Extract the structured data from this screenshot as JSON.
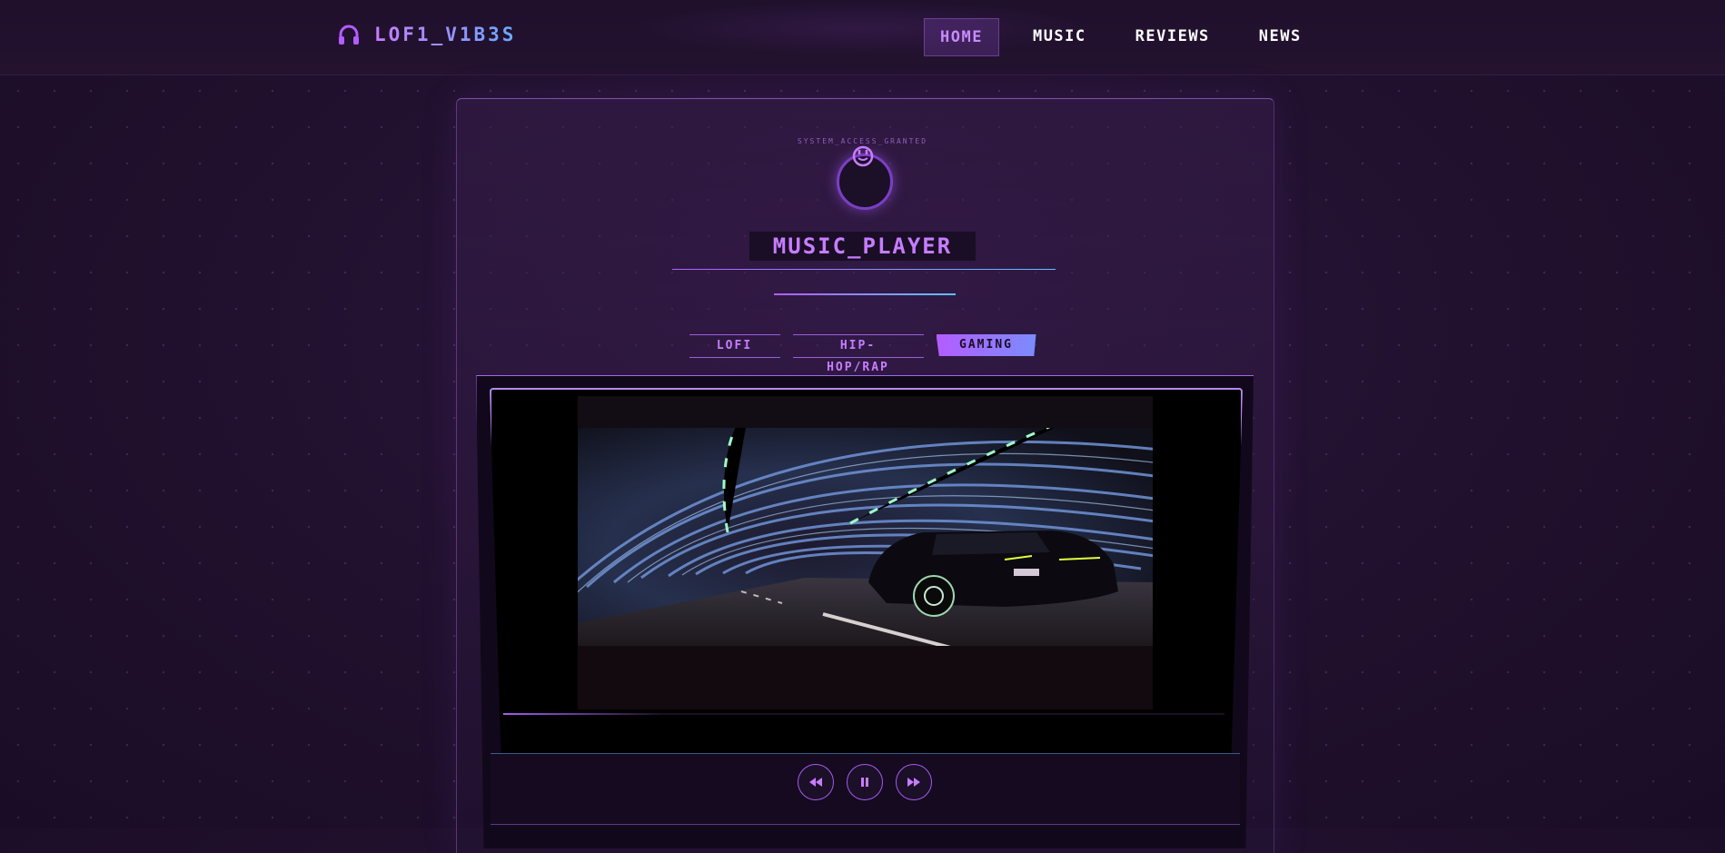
{
  "header": {
    "logo_text": "LOF1_V1B3S",
    "logo_icon": "headphones-icon",
    "nav": [
      {
        "label": "HOME",
        "active": true
      },
      {
        "label": "MUSIC",
        "active": false
      },
      {
        "label": "REVIEWS",
        "active": false
      },
      {
        "label": "NEWS",
        "active": false
      }
    ]
  },
  "profile": {
    "status_text": "SYSTEM_ACCESS_GRANTED",
    "avatar_icon": "smiley-icon",
    "title": "MUSIC_PLAYER"
  },
  "tabs": [
    {
      "label": "LOFI",
      "active": false
    },
    {
      "label": "HIP-HOP/RAP",
      "active": false
    },
    {
      "label": "GAMING",
      "active": true
    }
  ],
  "player": {
    "video_scene": "car driving through neon-lit tunnel",
    "progress": 0.22,
    "controls": [
      "rewind-icon",
      "pause-icon",
      "fast-forward-icon"
    ]
  },
  "colors": {
    "accent": "#c77dff",
    "accent_blue": "#5fc0ff",
    "background": "#22112f"
  }
}
